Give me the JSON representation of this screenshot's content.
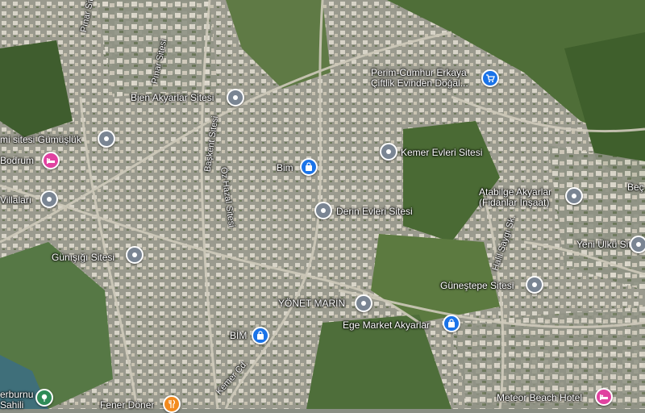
{
  "colors": {
    "place_pin": "#7a8593",
    "shop_pin": "#1a73e8",
    "hotel_pin": "#e042a0",
    "food_pin": "#f28a1e",
    "park_pin": "#2e8b57"
  },
  "places": [
    {
      "id": "pinar-sitesi-1",
      "label": "Pınar Sitesi",
      "type": "street"
    },
    {
      "id": "pinar-sitesi-2",
      "label": "Pınar Sitesi",
      "type": "street"
    },
    {
      "id": "perim",
      "label": "Perim-Cumhur Erkaya\nÇiftlik Evinden Doğal...",
      "type": "shop",
      "icon": "cart-icon"
    },
    {
      "id": "bien",
      "label": "Bien Akyarlar Sitesi",
      "type": "place",
      "icon": "place-icon"
    },
    {
      "id": "gumusluk",
      "label": "mi sitesi Gümüşlük",
      "type": "place",
      "icon": "place-icon"
    },
    {
      "id": "bodrum",
      "label": "Bodrum",
      "type": "hotel",
      "icon": "bed-icon"
    },
    {
      "id": "baskent",
      "label": "Başkent Sitesi",
      "type": "street"
    },
    {
      "id": "bim-1",
      "label": "Bim",
      "type": "shop",
      "icon": "bag-icon"
    },
    {
      "id": "kemer-evleri",
      "label": "Kemer Evleri Sitesi",
      "type": "place",
      "icon": "place-icon"
    },
    {
      "id": "oz-hazal",
      "label": "Öz Hazal Sitesi",
      "type": "street"
    },
    {
      "id": "villalari",
      "label": "Villaları",
      "type": "place",
      "icon": "place-icon"
    },
    {
      "id": "derin",
      "label": "Derin Evleri Sitesi",
      "type": "place",
      "icon": "place-icon"
    },
    {
      "id": "atabilge",
      "label": "Atabilge Akyarlar\n(Fidanlar İnşaat)",
      "type": "place",
      "icon": "place-icon"
    },
    {
      "id": "halil",
      "label": "Halil Saygı Sk.",
      "type": "street"
    },
    {
      "id": "bec",
      "label": "Beç",
      "type": "place"
    },
    {
      "id": "yeni-ulku",
      "label": "Yeni Ülkü Sitesi",
      "type": "place",
      "icon": "place-icon"
    },
    {
      "id": "gunisigi",
      "label": "Günışığı Sitesi",
      "type": "place",
      "icon": "place-icon"
    },
    {
      "id": "gunestepe",
      "label": "Güneştepe Sitesi",
      "type": "place",
      "icon": "place-icon"
    },
    {
      "id": "yonet",
      "label": "YÖNET MARİN",
      "type": "place",
      "icon": "place-icon"
    },
    {
      "id": "ege",
      "label": "Ege Market Akyarlar",
      "type": "shop",
      "icon": "bag-icon"
    },
    {
      "id": "bim-2",
      "label": "BİM",
      "type": "shop",
      "icon": "bag-icon"
    },
    {
      "id": "kemer-cd",
      "label": "Kemer Cd.",
      "type": "street"
    },
    {
      "id": "burnu",
      "label": "erburnu\nSahili",
      "type": "park",
      "icon": "park-icon"
    },
    {
      "id": "fener",
      "label": "Fener Döner",
      "type": "food",
      "icon": "fork-icon"
    },
    {
      "id": "meteor",
      "label": "Meteor Beach Hotel",
      "type": "hotel",
      "icon": "bed-icon"
    }
  ]
}
